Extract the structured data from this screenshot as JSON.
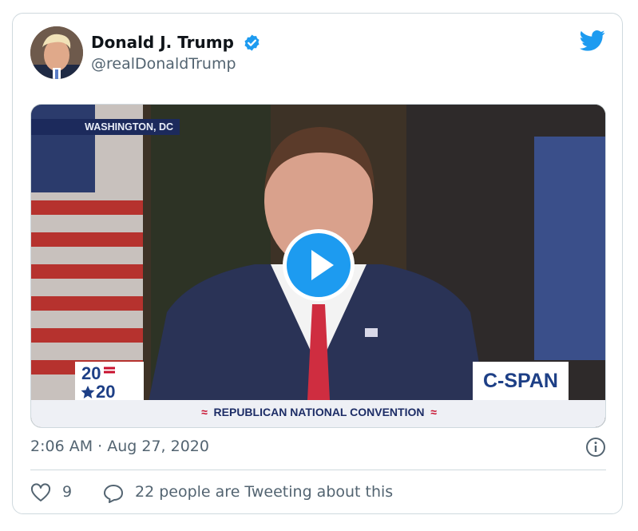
{
  "tweet": {
    "author_name": "Donald J. Trump",
    "handle": "@realDonaldTrump",
    "timestamp": "2:06 AM · Aug 27, 2020",
    "likes": "9",
    "tweeting": "22 people are Tweeting about this"
  },
  "video": {
    "location_label": "WASHINGTON, DC",
    "logo_2020_top": "20",
    "logo_2020_bottom": "20",
    "network_logo": "C-SPAN",
    "banner": "REPUBLICAN NATIONAL CONVENTION",
    "banner_stripe": "≈"
  },
  "colors": {
    "twitter_blue": "#1d9bf0",
    "text_secondary": "#536471",
    "border": "#cfd9de"
  },
  "icons": {
    "verified": "verified-badge-icon",
    "brand": "twitter-bird-icon",
    "play": "play-icon",
    "info": "info-icon",
    "like": "heart-icon",
    "reply": "speech-bubble-icon"
  }
}
